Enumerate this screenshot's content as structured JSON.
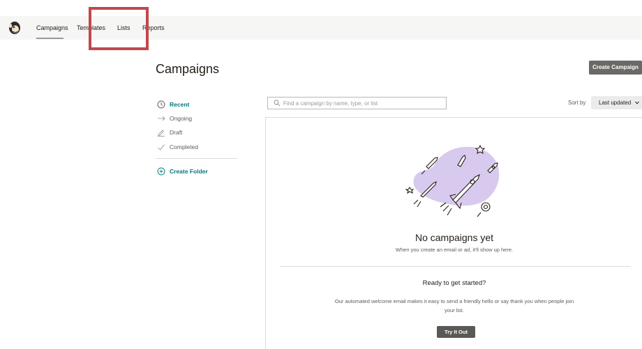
{
  "nav": {
    "logo": "mailchimp-logo",
    "items": [
      {
        "label": "Campaigns",
        "active": true
      },
      {
        "label": "Templates",
        "active": false
      },
      {
        "label": "Lists",
        "active": false
      },
      {
        "label": "Reports",
        "active": false
      }
    ],
    "highlight_color": "#c2474b"
  },
  "header": {
    "title": "Campaigns",
    "create_button": "Create Campaign"
  },
  "sidebar": {
    "items": [
      {
        "label": "Recent",
        "icon": "clock-icon",
        "active": true
      },
      {
        "label": "Ongoing",
        "icon": "arrow-right-icon",
        "active": false
      },
      {
        "label": "Draft",
        "icon": "pencil-icon",
        "active": false
      },
      {
        "label": "Completed",
        "icon": "checkmark-icon",
        "active": false
      }
    ],
    "create_folder": "Create Folder"
  },
  "toolbar": {
    "search_placeholder": "Find a campaign by name, type, or list",
    "sort_label": "Sort by",
    "sort_value": "Last updated"
  },
  "empty_state": {
    "title": "No campaigns yet",
    "subtitle": "When you create an email or ad, it'll show up here.",
    "ready_title": "Ready to get started?",
    "ready_body": "Our automated welcome email makes it easy to send a friendly hello or say thank you when people join your list.",
    "cta": "Try It Out"
  },
  "colors": {
    "accent": "#00797e",
    "button_dark": "#6b6965",
    "illustration_blob": "#d8c9ee"
  }
}
